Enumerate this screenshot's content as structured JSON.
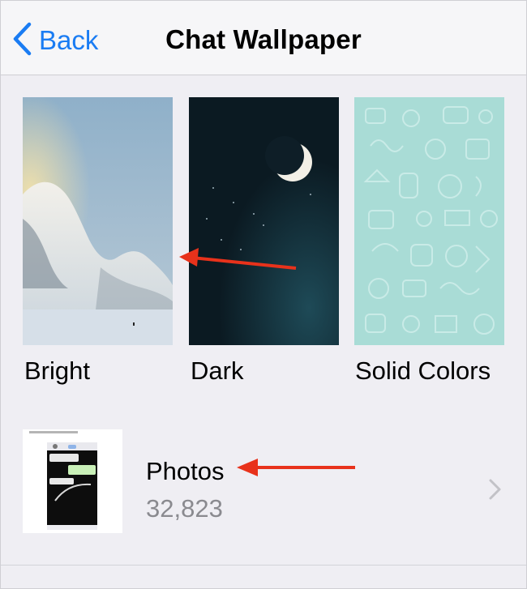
{
  "nav": {
    "back_label": "Back",
    "title": "Chat Wallpaper"
  },
  "wallpapers": [
    {
      "label": "Bright"
    },
    {
      "label": "Dark"
    },
    {
      "label": "Solid Colors"
    }
  ],
  "photos": {
    "label": "Photos",
    "count": "32,823"
  },
  "colors": {
    "accent": "#1a7cf3",
    "annotation": "#e8321b",
    "background": "#efeef3",
    "solid_wallpaper": "#a9dcd6"
  }
}
